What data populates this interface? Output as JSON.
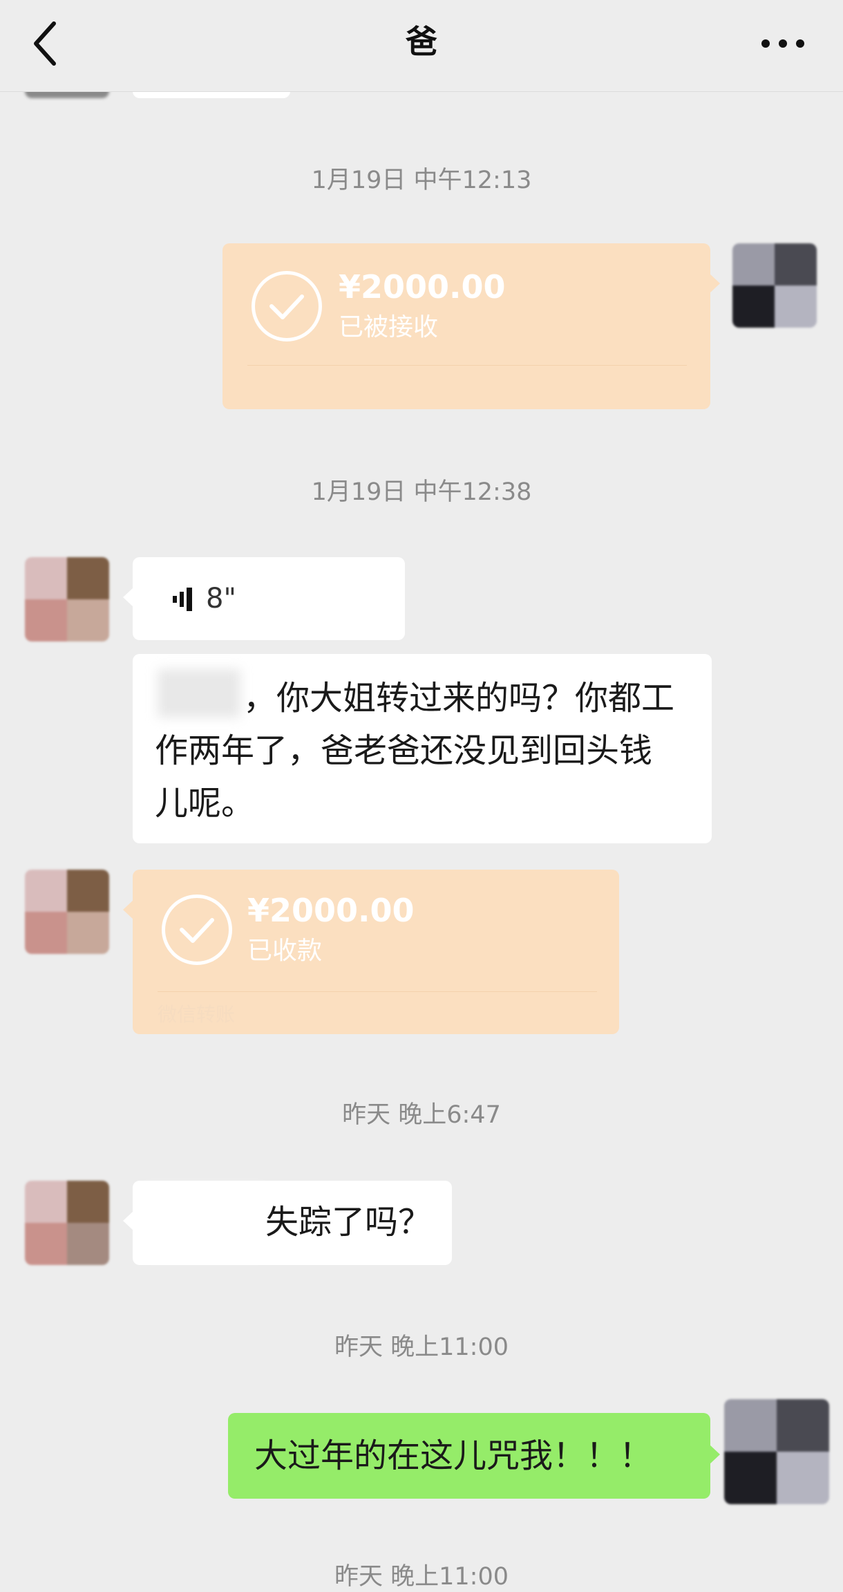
{
  "header": {
    "title": "爸",
    "back_icon": "chevron-left-icon",
    "more_icon": "more-dots-icon"
  },
  "messages": {
    "ts1": "1月19日 中午12:13",
    "transfer_sent": {
      "amount": "¥2000.00",
      "status": "已被接收"
    },
    "ts2": "1月19日 中午12:38",
    "voice": {
      "duration": "8\""
    },
    "text_dad_1": "你大姐转过来的吗？你都工作两年了，爸老爸还没见到回头钱儿呢。",
    "text_dad_1_lines": [
      "，你大姐转过来的吗？你都工",
      "作两年了，爸老爸还没见到回头钱",
      "儿呢。"
    ],
    "transfer_received": {
      "amount": "¥2000.00",
      "status": "已收款",
      "footer": "微信转账"
    },
    "ts3": "昨天 晚上6:47",
    "text_dad_2": "失踪了吗？",
    "ts4": "昨天 晚上11:00",
    "text_me_1": "大过年的在这儿咒我！！！",
    "ts5_partial": "昨天 晚上11:00"
  },
  "colors": {
    "background": "#ededed",
    "bubble_white": "#ffffff",
    "bubble_green": "#95ec69",
    "transfer_orange": "#fbdfc0"
  }
}
